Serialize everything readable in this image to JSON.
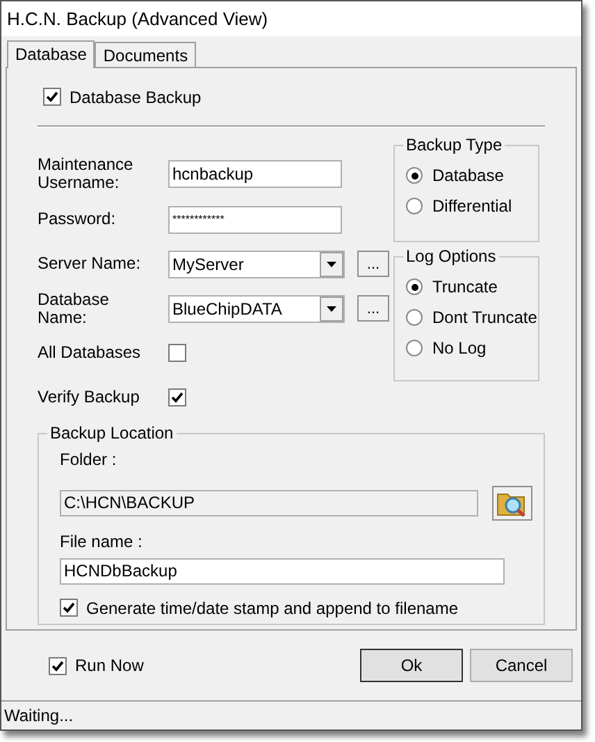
{
  "window": {
    "title": "H.C.N. Backup (Advanced View)"
  },
  "tabs": [
    {
      "label": "Database",
      "selected": true
    },
    {
      "label": "Documents",
      "selected": false
    }
  ],
  "database_backup": {
    "label": "Database Backup",
    "checked": true
  },
  "fields": [
    {
      "kind": "text",
      "label": "Maintenance Username:",
      "value": "hcnbackup"
    },
    {
      "kind": "password",
      "label": "Password:",
      "value": "************"
    },
    {
      "kind": "combo",
      "label": "Server Name:",
      "value": "MyServer",
      "button": "..."
    },
    {
      "kind": "combo",
      "label": "Database Name:",
      "value": "BlueChipDATA",
      "button": "..."
    },
    {
      "kind": "check",
      "label": "All Databases",
      "checked": false
    },
    {
      "kind": "check",
      "label": "Verify Backup",
      "checked": true
    }
  ],
  "backup_type": {
    "title": "Backup Type",
    "options": [
      {
        "label": "Database",
        "selected": true
      },
      {
        "label": "Differential",
        "selected": false
      }
    ]
  },
  "log_options": {
    "title": "Log Options",
    "options": [
      {
        "label": "Truncate",
        "selected": true
      },
      {
        "label": "Dont Truncate",
        "selected": false
      },
      {
        "label": "No Log",
        "selected": false
      }
    ]
  },
  "backup_location": {
    "title": "Backup Location",
    "folder_label": "Folder :",
    "folder": "C:\\HCN\\BACKUP",
    "file_label": "File name :",
    "file": "HCNDbBackup",
    "stamp": {
      "label": "Generate time/date stamp and append to filename",
      "checked": true
    }
  },
  "run_now": {
    "label": "Run Now",
    "checked": true
  },
  "buttons": [
    "Ok",
    "Cancel"
  ],
  "status_bar": "Waiting..."
}
